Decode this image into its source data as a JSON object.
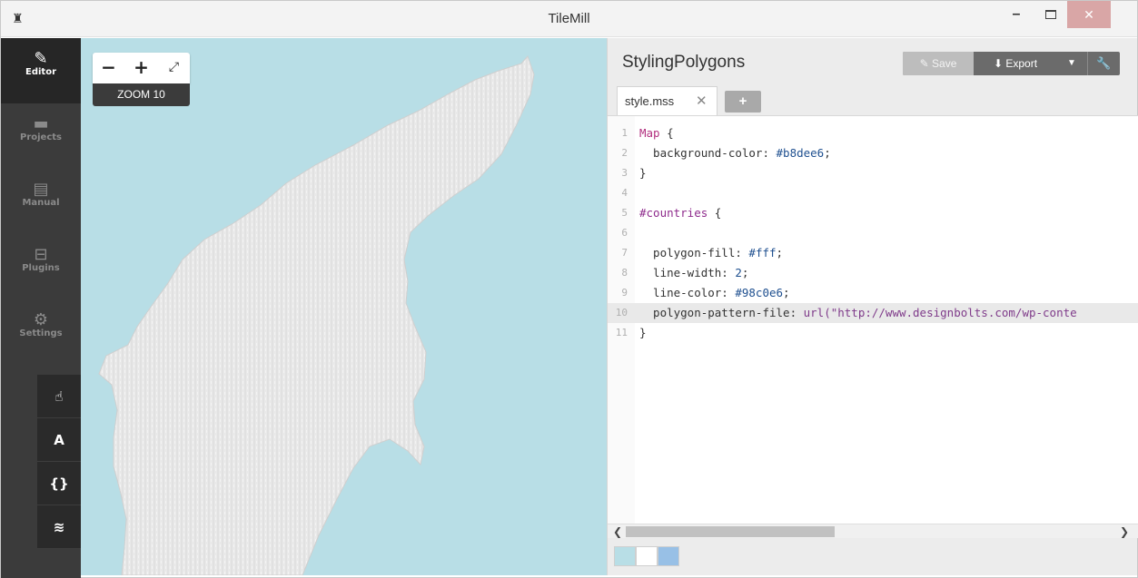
{
  "window": {
    "title": "TileMill",
    "app_icon": "tilemill-icon",
    "min_label": "–",
    "close_label": "✕"
  },
  "nav": {
    "items": [
      {
        "id": "editor",
        "label": "Editor",
        "icon": "pencil-icon",
        "glyph": "✎",
        "active": true
      },
      {
        "id": "projects",
        "label": "Projects",
        "icon": "folder-icon",
        "glyph": "▬",
        "active": false
      },
      {
        "id": "manual",
        "label": "Manual",
        "icon": "book-icon",
        "glyph": "▤",
        "active": false
      },
      {
        "id": "plugins",
        "label": "Plugins",
        "icon": "plugin-icon",
        "glyph": "⊟",
        "active": false
      },
      {
        "id": "settings",
        "label": "Settings",
        "icon": "gear-icon",
        "glyph": "⚙",
        "active": false
      }
    ],
    "tools": [
      {
        "id": "pan",
        "icon": "hand-pointer-icon",
        "glyph": "☝"
      },
      {
        "id": "fonts",
        "icon": "font-icon",
        "glyph": "A"
      },
      {
        "id": "carto",
        "icon": "braces-icon",
        "glyph": "{}"
      },
      {
        "id": "layers",
        "icon": "layers-icon",
        "glyph": "≋"
      }
    ]
  },
  "map": {
    "zoom_out": "−",
    "zoom_in": "+",
    "fullscreen": "⤢",
    "zoom_label": "ZOOM 10",
    "water_color": "#b8dee6",
    "land_color": "#e8e8e8"
  },
  "editor": {
    "project_title": "StylingPolygons",
    "save_label": "Save",
    "export_label": "Export",
    "tab_label": "style.mss",
    "tab_close": "✕",
    "tab_add": "+",
    "code": [
      {
        "n": "1",
        "parts": [
          {
            "t": "Map",
            "c": "tok-sel"
          },
          {
            "t": " {",
            "c": "tok-prop"
          }
        ]
      },
      {
        "n": "2",
        "parts": [
          {
            "t": "  background-color: ",
            "c": "tok-prop"
          },
          {
            "t": "#b8dee6",
            "c": "tok-val"
          },
          {
            "t": ";",
            "c": "tok-prop"
          }
        ]
      },
      {
        "n": "3",
        "parts": [
          {
            "t": "}",
            "c": "tok-prop"
          }
        ]
      },
      {
        "n": "4",
        "parts": []
      },
      {
        "n": "5",
        "parts": [
          {
            "t": "#countries",
            "c": "tok-id"
          },
          {
            "t": " {",
            "c": "tok-prop"
          }
        ]
      },
      {
        "n": "6",
        "parts": []
      },
      {
        "n": "7",
        "parts": [
          {
            "t": "  polygon-fill: ",
            "c": "tok-prop"
          },
          {
            "t": "#fff",
            "c": "tok-val"
          },
          {
            "t": ";",
            "c": "tok-prop"
          }
        ]
      },
      {
        "n": "8",
        "parts": [
          {
            "t": "  line-width: ",
            "c": "tok-prop"
          },
          {
            "t": "2",
            "c": "tok-val"
          },
          {
            "t": ";",
            "c": "tok-prop"
          }
        ]
      },
      {
        "n": "9",
        "parts": [
          {
            "t": "  line-color: ",
            "c": "tok-prop"
          },
          {
            "t": "#98c0e6",
            "c": "tok-val"
          },
          {
            "t": ";",
            "c": "tok-prop"
          }
        ]
      },
      {
        "n": "10",
        "parts": [
          {
            "t": "  polygon-pattern-file: ",
            "c": "tok-prop"
          },
          {
            "t": "url(\"http://www.designbolts.com/wp-conte",
            "c": "tok-str"
          }
        ],
        "highlight": true
      },
      {
        "n": "11",
        "parts": [
          {
            "t": "}",
            "c": "tok-prop"
          }
        ]
      }
    ],
    "palette": [
      "#b8dee6",
      "#ffffff",
      "#98c0e6"
    ]
  }
}
